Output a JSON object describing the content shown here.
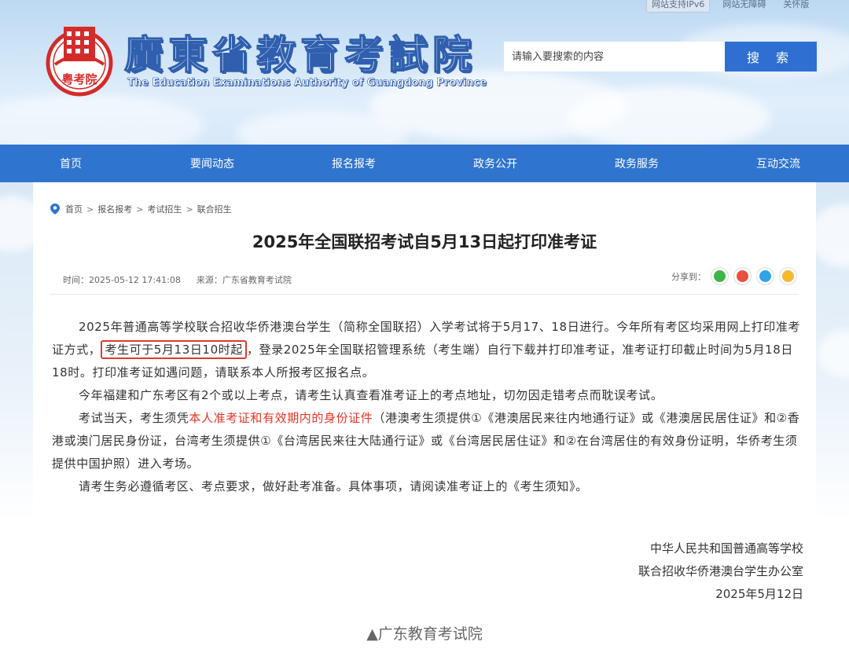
{
  "header": {
    "site_title": "廣東省教育考試院",
    "site_subtitle": "The Education Examinations Authority of Guangdong Province",
    "seal_text": "粤考院",
    "top_links": [
      "网站支持IPv6",
      "网站无障碍",
      "关怀版"
    ],
    "search": {
      "placeholder": "请输入要搜索的内容",
      "button_label": "搜 索"
    }
  },
  "nav": {
    "items": [
      "首页",
      "要闻动态",
      "报名报考",
      "政务公开",
      "政务服务",
      "互动交流"
    ]
  },
  "breadcrumb": [
    "首页",
    "报名报考",
    "考试招生",
    "联合招生"
  ],
  "article": {
    "title": "2025年全国联招考试自5月13日起打印准考证",
    "time": "时间：2025-05-12 17:41:08",
    "source": "来源：广东省教育考试院",
    "share_label": "分享到：",
    "p1_a": "2025年普通高等学校联合招收华侨港澳台学生（简称全国联招）入学考试将于5月17、18日进行。今年所有考区均采用网上打印准考证方式，",
    "p1_boxed": "考生可于5月13日10时起",
    "p1_b": "，登录2025年全国联招管理系统（考生端）自行下载并打印准考证，准考证打印截止时间为5月18日18时。打印准考证如遇问题，请联系本人所报考区报名点。",
    "p2": "今年福建和广东考区有2个或以上考点，请考生认真查看准考证上的考点地址，切勿因走错考点而耽误考试。",
    "p3_a": "考试当天，考生须凭",
    "p3_red": "本人准考证和有效期内的身份证件",
    "p3_b": "（港澳考生须提供①《港澳居民来往内地通行证》或《港澳居民居住证》和②香港或澳门居民身份证，台湾考生须提供①《台湾居民来往大陆通行证》或《台湾居民居住证》和②在台湾居住的有效身份证明，华侨考生须提供中国护照）进入考场。",
    "p4": "请考生务必遵循考区、考点要求，做好赴考准备。具体事项，请阅读准考证上的《考生须知》。",
    "sign_org1": "中华人民共和国普通高等学校",
    "sign_org2": "联合招收华侨港澳台学生办公室",
    "sign_date": "2025年5月12日"
  },
  "caption": "▲广东教育考试院",
  "colors": {
    "nav_bg": "#2f74cf",
    "search_btn": "#2f6fd1",
    "highlight_red": "#e53524",
    "seal_red": "#d42b2b"
  },
  "icons": [
    "location-pin-icon",
    "wechat-icon",
    "weibo-icon",
    "qq-icon",
    "qzone-icon"
  ]
}
